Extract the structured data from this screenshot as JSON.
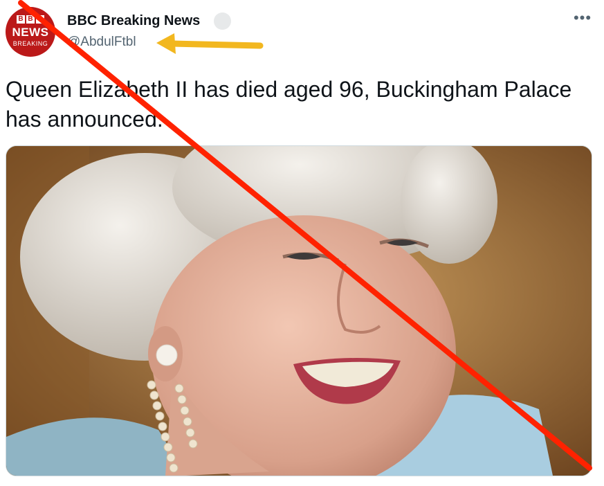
{
  "tweet": {
    "avatar": {
      "logo_letters": [
        "B",
        "B",
        "C"
      ],
      "logo_word": "NEWS",
      "logo_sub": "BREAKING",
      "brand_color": "#bb1919"
    },
    "display_name": "BBC Breaking News",
    "handle": "@AbdulFtbl",
    "more_icon": "more-horizontal-icon",
    "more_glyph": "•••",
    "text": "Queen Elizabeth II has died aged 96, Buckingham Palace has announced.",
    "colors": {
      "text": "#0f1419",
      "secondary": "#536471",
      "annotation_arrow": "#f2b71f",
      "annotation_cross": "#ff2200"
    }
  }
}
